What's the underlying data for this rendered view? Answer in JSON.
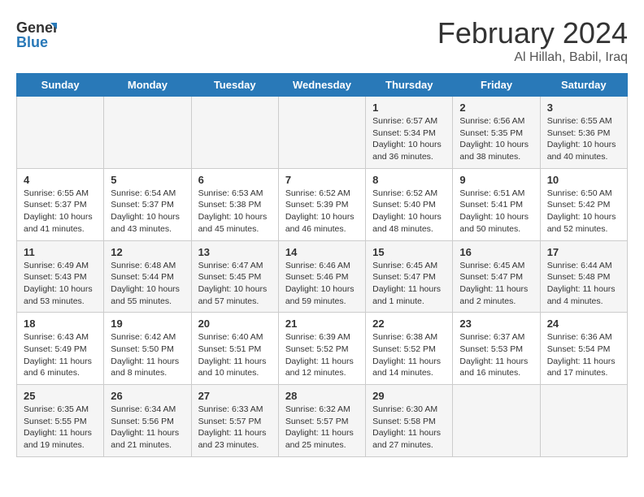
{
  "logo": {
    "line1": "General",
    "line2": "Blue"
  },
  "title": "February 2024",
  "location": "Al Hillah, Babil, Iraq",
  "headers": [
    "Sunday",
    "Monday",
    "Tuesday",
    "Wednesday",
    "Thursday",
    "Friday",
    "Saturday"
  ],
  "weeks": [
    [
      {
        "day": "",
        "info": ""
      },
      {
        "day": "",
        "info": ""
      },
      {
        "day": "",
        "info": ""
      },
      {
        "day": "",
        "info": ""
      },
      {
        "day": "1",
        "info": "Sunrise: 6:57 AM\nSunset: 5:34 PM\nDaylight: 10 hours\nand 36 minutes."
      },
      {
        "day": "2",
        "info": "Sunrise: 6:56 AM\nSunset: 5:35 PM\nDaylight: 10 hours\nand 38 minutes."
      },
      {
        "day": "3",
        "info": "Sunrise: 6:55 AM\nSunset: 5:36 PM\nDaylight: 10 hours\nand 40 minutes."
      }
    ],
    [
      {
        "day": "4",
        "info": "Sunrise: 6:55 AM\nSunset: 5:37 PM\nDaylight: 10 hours\nand 41 minutes."
      },
      {
        "day": "5",
        "info": "Sunrise: 6:54 AM\nSunset: 5:37 PM\nDaylight: 10 hours\nand 43 minutes."
      },
      {
        "day": "6",
        "info": "Sunrise: 6:53 AM\nSunset: 5:38 PM\nDaylight: 10 hours\nand 45 minutes."
      },
      {
        "day": "7",
        "info": "Sunrise: 6:52 AM\nSunset: 5:39 PM\nDaylight: 10 hours\nand 46 minutes."
      },
      {
        "day": "8",
        "info": "Sunrise: 6:52 AM\nSunset: 5:40 PM\nDaylight: 10 hours\nand 48 minutes."
      },
      {
        "day": "9",
        "info": "Sunrise: 6:51 AM\nSunset: 5:41 PM\nDaylight: 10 hours\nand 50 minutes."
      },
      {
        "day": "10",
        "info": "Sunrise: 6:50 AM\nSunset: 5:42 PM\nDaylight: 10 hours\nand 52 minutes."
      }
    ],
    [
      {
        "day": "11",
        "info": "Sunrise: 6:49 AM\nSunset: 5:43 PM\nDaylight: 10 hours\nand 53 minutes."
      },
      {
        "day": "12",
        "info": "Sunrise: 6:48 AM\nSunset: 5:44 PM\nDaylight: 10 hours\nand 55 minutes."
      },
      {
        "day": "13",
        "info": "Sunrise: 6:47 AM\nSunset: 5:45 PM\nDaylight: 10 hours\nand 57 minutes."
      },
      {
        "day": "14",
        "info": "Sunrise: 6:46 AM\nSunset: 5:46 PM\nDaylight: 10 hours\nand 59 minutes."
      },
      {
        "day": "15",
        "info": "Sunrise: 6:45 AM\nSunset: 5:47 PM\nDaylight: 11 hours\nand 1 minute."
      },
      {
        "day": "16",
        "info": "Sunrise: 6:45 AM\nSunset: 5:47 PM\nDaylight: 11 hours\nand 2 minutes."
      },
      {
        "day": "17",
        "info": "Sunrise: 6:44 AM\nSunset: 5:48 PM\nDaylight: 11 hours\nand 4 minutes."
      }
    ],
    [
      {
        "day": "18",
        "info": "Sunrise: 6:43 AM\nSunset: 5:49 PM\nDaylight: 11 hours\nand 6 minutes."
      },
      {
        "day": "19",
        "info": "Sunrise: 6:42 AM\nSunset: 5:50 PM\nDaylight: 11 hours\nand 8 minutes."
      },
      {
        "day": "20",
        "info": "Sunrise: 6:40 AM\nSunset: 5:51 PM\nDaylight: 11 hours\nand 10 minutes."
      },
      {
        "day": "21",
        "info": "Sunrise: 6:39 AM\nSunset: 5:52 PM\nDaylight: 11 hours\nand 12 minutes."
      },
      {
        "day": "22",
        "info": "Sunrise: 6:38 AM\nSunset: 5:52 PM\nDaylight: 11 hours\nand 14 minutes."
      },
      {
        "day": "23",
        "info": "Sunrise: 6:37 AM\nSunset: 5:53 PM\nDaylight: 11 hours\nand 16 minutes."
      },
      {
        "day": "24",
        "info": "Sunrise: 6:36 AM\nSunset: 5:54 PM\nDaylight: 11 hours\nand 17 minutes."
      }
    ],
    [
      {
        "day": "25",
        "info": "Sunrise: 6:35 AM\nSunset: 5:55 PM\nDaylight: 11 hours\nand 19 minutes."
      },
      {
        "day": "26",
        "info": "Sunrise: 6:34 AM\nSunset: 5:56 PM\nDaylight: 11 hours\nand 21 minutes."
      },
      {
        "day": "27",
        "info": "Sunrise: 6:33 AM\nSunset: 5:57 PM\nDaylight: 11 hours\nand 23 minutes."
      },
      {
        "day": "28",
        "info": "Sunrise: 6:32 AM\nSunset: 5:57 PM\nDaylight: 11 hours\nand 25 minutes."
      },
      {
        "day": "29",
        "info": "Sunrise: 6:30 AM\nSunset: 5:58 PM\nDaylight: 11 hours\nand 27 minutes."
      },
      {
        "day": "",
        "info": ""
      },
      {
        "day": "",
        "info": ""
      }
    ]
  ]
}
